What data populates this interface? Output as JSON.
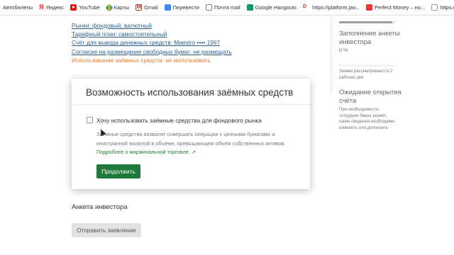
{
  "bookmarks": [
    {
      "label": "Автобилеты",
      "icon": "none"
    },
    {
      "label": "Яндекс",
      "icon": "yandex-icon"
    },
    {
      "label": "YouTube",
      "icon": "youtube-icon"
    },
    {
      "label": "Карты",
      "icon": "maps-icon"
    },
    {
      "label": "Gmail",
      "icon": "gmail-icon"
    },
    {
      "label": "Перевести",
      "icon": "translate-icon"
    },
    {
      "label": "Почта mail",
      "icon": "mail-icon"
    },
    {
      "label": "Google Hangouts",
      "icon": "hangouts-icon"
    },
    {
      "label": "https://platform.jav...",
      "icon": "platform-icon"
    },
    {
      "label": "Perfect Money – но...",
      "icon": "perfect-money-icon"
    },
    {
      "label": "https://login.mos.ru...",
      "icon": "page-icon"
    }
  ],
  "settings_links": [
    {
      "label": "Рынки: фондовый, валютный"
    },
    {
      "label": "Тарифный план: самостоятельный"
    },
    {
      "label": "Счёт для вывода денежных средств: Maestro •••• 1967"
    },
    {
      "label": "Согласие на размещение свободных бумаг: не размещать"
    },
    {
      "label": "Использование заёмных средств: не использовать"
    }
  ],
  "card": {
    "title": "Возможность использования заёмных средств",
    "checkbox_label": "Хочу использовать заёмные средства для фондового рынка",
    "checkbox_checked": false,
    "description": "Заёмные средства позволят совершать операции с ценными бумагами и иностранной валютой в объёме, превышающем объём собственных активов.",
    "more_link": "Подробнее о маржинальной торговле.",
    "continue_button": "Продолжить"
  },
  "investor_section": {
    "title": "Анкета инвестора",
    "submit_button": "Отправить заявление"
  },
  "sidebar": {
    "progress_fraction": 0.95,
    "fill_title": "Заполнение анкеты инвестора",
    "fill_percent": "0 %",
    "fill_note": "Заявки рассматриваются 2 рабочих дня",
    "wait_title": "Ожидание открытия счёта",
    "wait_note": "При необходимости, сотрудник банка укажет, какие сведения необходимо изменить или дополнить"
  },
  "colors": {
    "link": "#2d5f8b",
    "link_active": "#e07a2e",
    "primary_button": "#1f7a3a",
    "disabled_button": "#e2e2e2"
  }
}
